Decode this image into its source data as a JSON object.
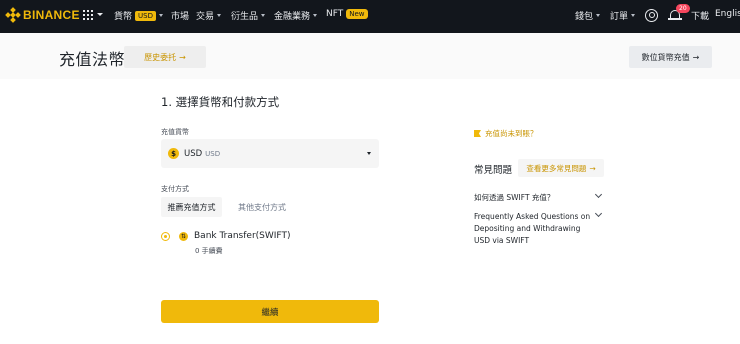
{
  "nav": {
    "brand": "BINANCE",
    "items": [
      {
        "label": "貨幣",
        "badge": "USD"
      },
      {
        "label": "市場"
      },
      {
        "label": "交易"
      },
      {
        "label": "衍生品"
      },
      {
        "label": "金融業務"
      },
      {
        "label": "NFT",
        "badge": "New"
      }
    ],
    "right": {
      "wallet": "錢包",
      "orders": "訂單",
      "notifications": "20",
      "download": "下載",
      "language": "English"
    }
  },
  "header": {
    "title": "充值法幣",
    "history_button": "歷史委托",
    "crypto_deposit_button": "數位貨幣充值"
  },
  "form": {
    "step_title": "1. 選擇貨幣和付款方式",
    "currency_label": "充值貨幣",
    "currency_code": "USD",
    "currency_sub": "USD",
    "payment_label": "支付方式",
    "tabs": [
      "推薦充值方式",
      "其他支付方式"
    ],
    "method_name": "Bank Transfer(SWIFT)",
    "method_fee": "0 手續費",
    "continue_button": "繼續"
  },
  "sidebar": {
    "not_received": "充值尚未到賬？",
    "faq_title": "常見問題",
    "faq_more": "查看更多常見問題",
    "questions": [
      "如何透過 SWIFT 充值？",
      "Frequently Asked Questions on Depositing and Withdrawing USD via SWIFT"
    ]
  },
  "colors": {
    "brand": "#f0b90b",
    "nav_bg": "#12161c",
    "link": "#c99400"
  }
}
